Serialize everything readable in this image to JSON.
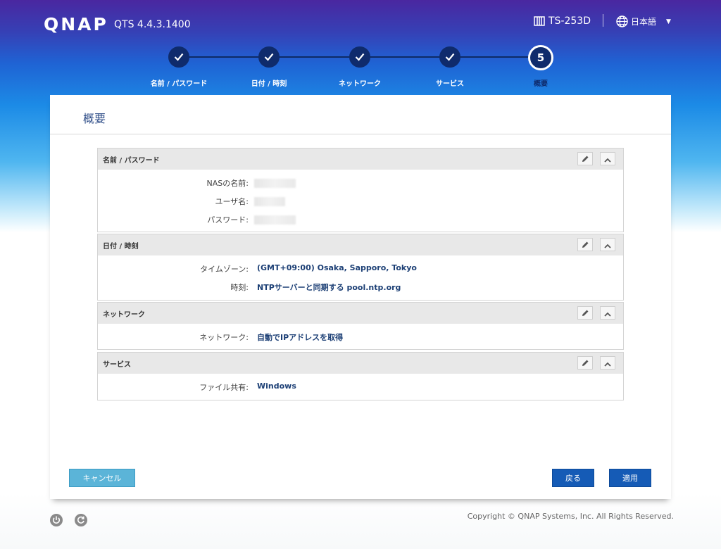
{
  "header": {
    "brand": "QNAP",
    "version": "QTS 4.4.3.1400",
    "model": "TS-253D",
    "language": "日本語"
  },
  "stepper": {
    "steps": [
      {
        "label": "名前 / パスワード",
        "state": "done"
      },
      {
        "label": "日付 / 時刻",
        "state": "done"
      },
      {
        "label": "ネットワーク",
        "state": "done"
      },
      {
        "label": "サービス",
        "state": "done"
      },
      {
        "label": "概要",
        "state": "active",
        "number": "5"
      }
    ]
  },
  "page": {
    "title": "概要"
  },
  "sections": {
    "name_password": {
      "title": "名前 / パスワード",
      "rows": [
        {
          "label": "NASの名前:",
          "value": ""
        },
        {
          "label": "ユーザ名:",
          "value": ""
        },
        {
          "label": "パスワード:",
          "value": ""
        }
      ]
    },
    "datetime": {
      "title": "日付 / 時刻",
      "rows": [
        {
          "label": "タイムゾーン:",
          "value": "(GMT+09:00) Osaka, Sapporo, Tokyo"
        },
        {
          "label": "時刻:",
          "value": "NTPサーバーと同期する pool.ntp.org"
        }
      ]
    },
    "network": {
      "title": "ネットワーク",
      "rows": [
        {
          "label": "ネットワーク:",
          "value": "自動でIPアドレスを取得"
        }
      ]
    },
    "services": {
      "title": "サービス",
      "rows": [
        {
          "label": "ファイル共有:",
          "value": "Windows"
        }
      ]
    }
  },
  "buttons": {
    "cancel": "キャンセル",
    "back": "戻る",
    "apply": "適用"
  },
  "footer": {
    "copyright": "Copyright © QNAP Systems, Inc. All Rights Reserved."
  },
  "colors": {
    "accent": "#155bb6",
    "cancel": "#5bb4d8",
    "step": "#0f2b6c",
    "value_text": "#1c3f75"
  },
  "icons": [
    "nas-device-icon",
    "globe-icon",
    "check-icon",
    "edit-pencil-icon",
    "collapse-chevron-icon",
    "power-icon",
    "restart-icon"
  ]
}
